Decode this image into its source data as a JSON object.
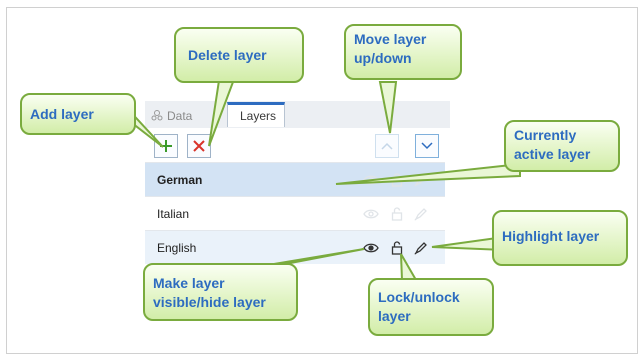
{
  "tabs": {
    "data": "Data",
    "layers": "Layers"
  },
  "layers": [
    {
      "name": "German",
      "active": true
    },
    {
      "name": "Italian",
      "active": false
    },
    {
      "name": "English",
      "active": false
    }
  ],
  "callouts": {
    "add_layer": "Add layer",
    "delete_layer": "Delete layer",
    "move_layer": "Move layer up/down",
    "currently_active": "Currently active layer",
    "highlight_layer": "Highlight layer",
    "make_visible": "Make layer visible/hide layer",
    "lock_unlock": "Lock/unlock layer"
  },
  "colors": {
    "callout_text": "#2d6cc0",
    "callout_border": "#7aab3e",
    "add": "#3a9a2a",
    "delete": "#d9342b",
    "active_row": "#d3e3f4"
  }
}
